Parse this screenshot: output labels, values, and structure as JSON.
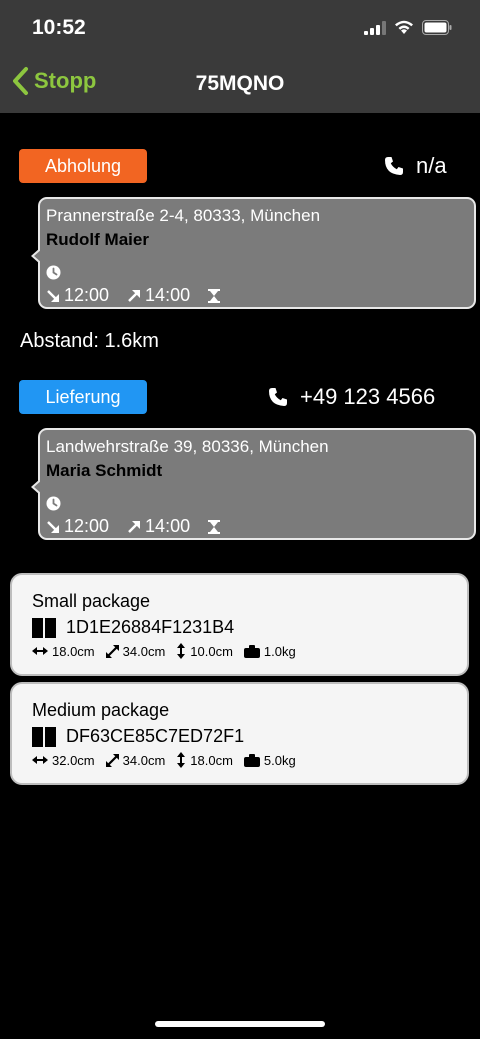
{
  "status_bar": {
    "time": "10:52"
  },
  "nav": {
    "back_label": "Stopp",
    "title": "75MQNO"
  },
  "pickup": {
    "badge": "Abholung",
    "badge_color": "#f26522",
    "phone": "n/a",
    "address": "Prannerstraße 2-4, 80333, München",
    "name": "Rudolf Maier",
    "time_from": "12:00",
    "time_to": "14:00"
  },
  "distance": "Abstand: 1.6km",
  "delivery": {
    "badge": "Lieferung",
    "badge_color": "#2196f3",
    "phone": "+49 123 4566",
    "address": "Landwehrstraße 39, 80336, München",
    "name": "Maria Schmidt",
    "time_from": "12:00",
    "time_to": "14:00"
  },
  "packages": [
    {
      "name": "Small package",
      "barcode": "1D1E26884F1231B4",
      "length": "18.0cm",
      "width": "34.0cm",
      "height": "10.0cm",
      "weight": "1.0kg"
    },
    {
      "name": "Medium package",
      "barcode": "DF63CE85C7ED72F1",
      "length": "32.0cm",
      "width": "34.0cm",
      "height": "18.0cm",
      "weight": "5.0kg"
    }
  ],
  "icons": [
    "signal-icon",
    "wifi-icon",
    "battery-icon",
    "chevron-left-icon",
    "phone-icon",
    "clock-icon",
    "arrow-in-icon",
    "arrow-out-icon",
    "hourglass-icon",
    "book-icon",
    "width-arrow-icon",
    "diagonal-arrow-icon",
    "height-arrow-icon",
    "weight-icon"
  ]
}
